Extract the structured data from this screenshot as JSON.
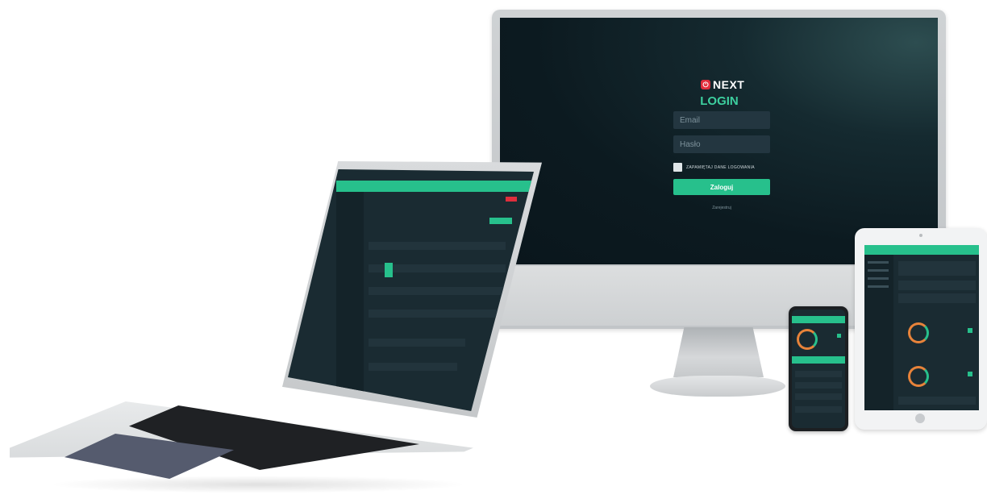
{
  "colors": {
    "accent": "#27c08c",
    "title_green": "#3dcf9f",
    "logo_red": "#e02e3c",
    "screen_bg": "#0c1a20",
    "input_bg": "#233640"
  },
  "login": {
    "logo_text": "NEXT",
    "title": "LOGIN",
    "email_placeholder": "Email",
    "password_placeholder": "Hasło",
    "remember_label": "ZAPAMIĘTAJ DANE LOGOWANIA",
    "submit_label": "Zaloguj",
    "register_link": "Zarejestruj"
  }
}
